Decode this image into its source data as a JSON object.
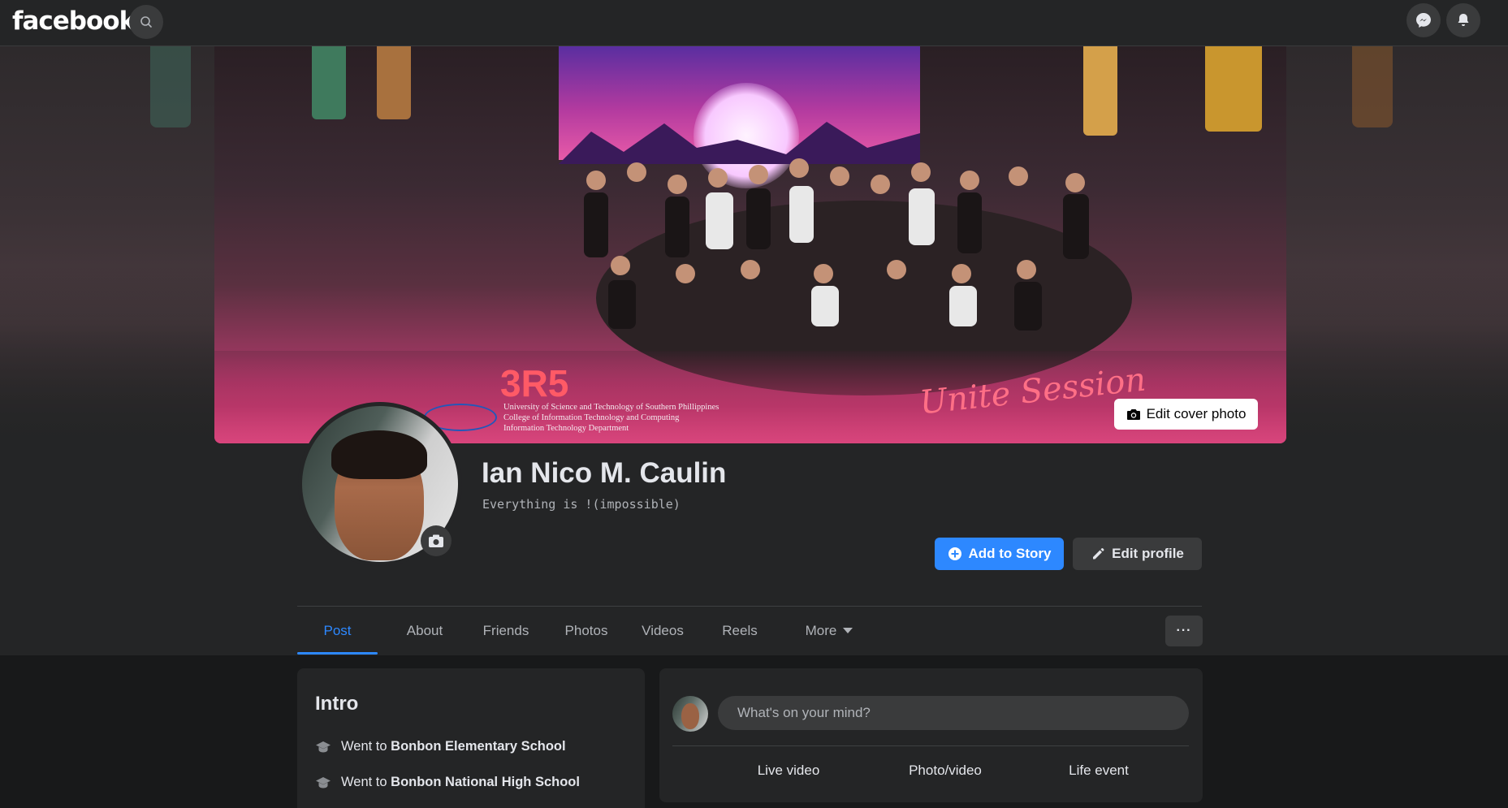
{
  "topbar": {
    "logo": "facebook",
    "search_icon": "search-icon",
    "messenger_icon": "messenger-icon",
    "notifications_icon": "bell-icon"
  },
  "cover": {
    "tag": "3R5",
    "institution_lines": [
      "University of Science and Technology of Southern Phillippines",
      "College of Information Technology and Computing",
      "Information Technology Department"
    ],
    "script_text": "Unite Session",
    "edit_cover_label": "Edit cover photo"
  },
  "profile": {
    "name": "Ian Nico M. Caulin",
    "bio": "Everything is !(impossible)"
  },
  "actions": {
    "add_story": "Add to Story",
    "edit_profile": "Edit profile"
  },
  "tabs": [
    {
      "label": "Post",
      "active": true
    },
    {
      "label": "About"
    },
    {
      "label": "Friends"
    },
    {
      "label": "Photos"
    },
    {
      "label": "Videos"
    },
    {
      "label": "Reels"
    },
    {
      "label": "More"
    }
  ],
  "more_options": "···",
  "intro": {
    "title": "Intro",
    "items": [
      {
        "prefix": "Went to",
        "place": "Bonbon Elementary School"
      },
      {
        "prefix": "Went to",
        "place": "Bonbon National High School"
      }
    ]
  },
  "composer": {
    "placeholder": "What's on your mind?",
    "actions": [
      "Live video",
      "Photo/video",
      "Life event"
    ]
  },
  "colors": {
    "accent": "#2d88ff",
    "background": "#18191a",
    "card": "#242526"
  }
}
